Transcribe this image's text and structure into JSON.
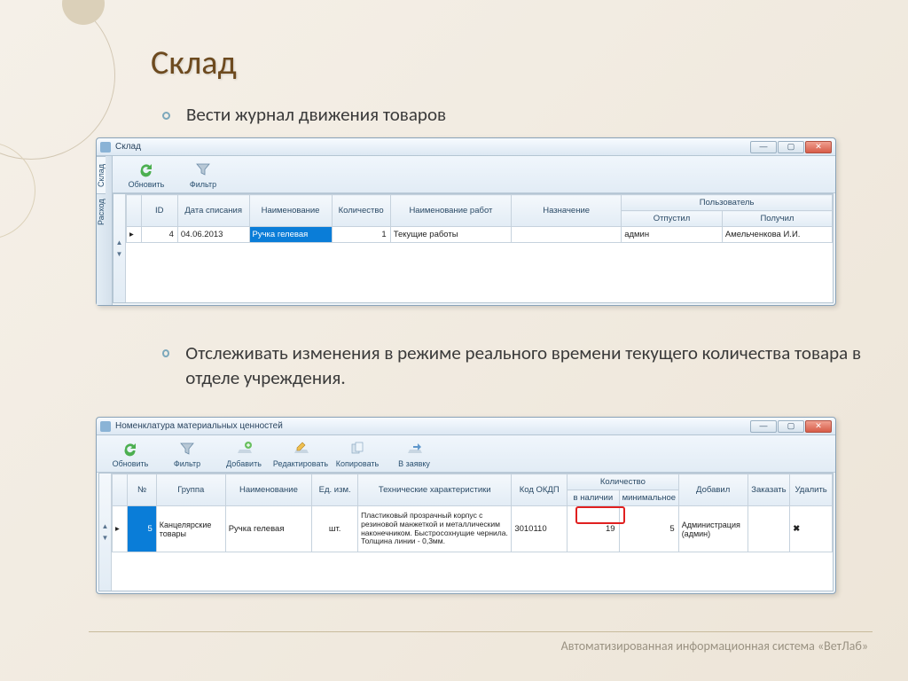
{
  "slide": {
    "title": "Склад",
    "bullet1": "Вести журнал движения товаров",
    "bullet2": "Отслеживать изменения в режиме реального времени текущего количества товара в отделе учреждения.",
    "footer": "Автоматизированная информационная система «ВетЛаб»"
  },
  "win1": {
    "title": "Склад",
    "vtabs": [
      "Склад",
      "Расход"
    ],
    "toolbar": [
      {
        "label": "Обновить",
        "icon": "refresh"
      },
      {
        "label": "Фильтр",
        "icon": "filter"
      }
    ],
    "headers": {
      "id": "ID",
      "date": "Дата списания",
      "name": "Наименование",
      "qty": "Количество",
      "work": "Наименование работ",
      "purpose": "Назначение",
      "user_group": "Пользователь",
      "sent": "Отпустил",
      "recv": "Получил"
    },
    "row": {
      "id": "4",
      "date": "04.06.2013",
      "name": "Ручка гелевая",
      "qty": "1",
      "work": "Текущие работы",
      "purpose": "",
      "sent": "админ",
      "recv": "Амельченкова И.И."
    }
  },
  "win2": {
    "title": "Номенклатура материальных ценностей",
    "toolbar": [
      {
        "label": "Обновить",
        "icon": "refresh"
      },
      {
        "label": "Фильтр",
        "icon": "filter"
      },
      {
        "label": "Добавить",
        "icon": "add"
      },
      {
        "label": "Редактировать",
        "icon": "edit"
      },
      {
        "label": "Копировать",
        "icon": "copy"
      },
      {
        "label": "В заявку",
        "icon": "request"
      }
    ],
    "headers": {
      "no": "№",
      "group": "Группа",
      "name": "Наименование",
      "unit": "Ед. изм.",
      "tech": "Технические характеристики",
      "okdp": "Код ОКДП",
      "qty_group": "Количество",
      "in_stock": "в наличии",
      "min": "минимальное",
      "added": "Добавил",
      "order": "Заказать",
      "delete": "Удалить"
    },
    "row": {
      "no": "5",
      "group": "Канцелярские товары",
      "name": "Ручка гелевая",
      "unit": "шт.",
      "tech": "Пластиковый прозрачный корпус с резиновой манжеткой и металлическим наконечником. Быстросохнущие чернила. Толщина линии - 0,3мм.",
      "okdp": "3010110",
      "in_stock": "19",
      "min": "5",
      "added": "Администрация (админ)",
      "order": "",
      "delete": "✖"
    }
  }
}
